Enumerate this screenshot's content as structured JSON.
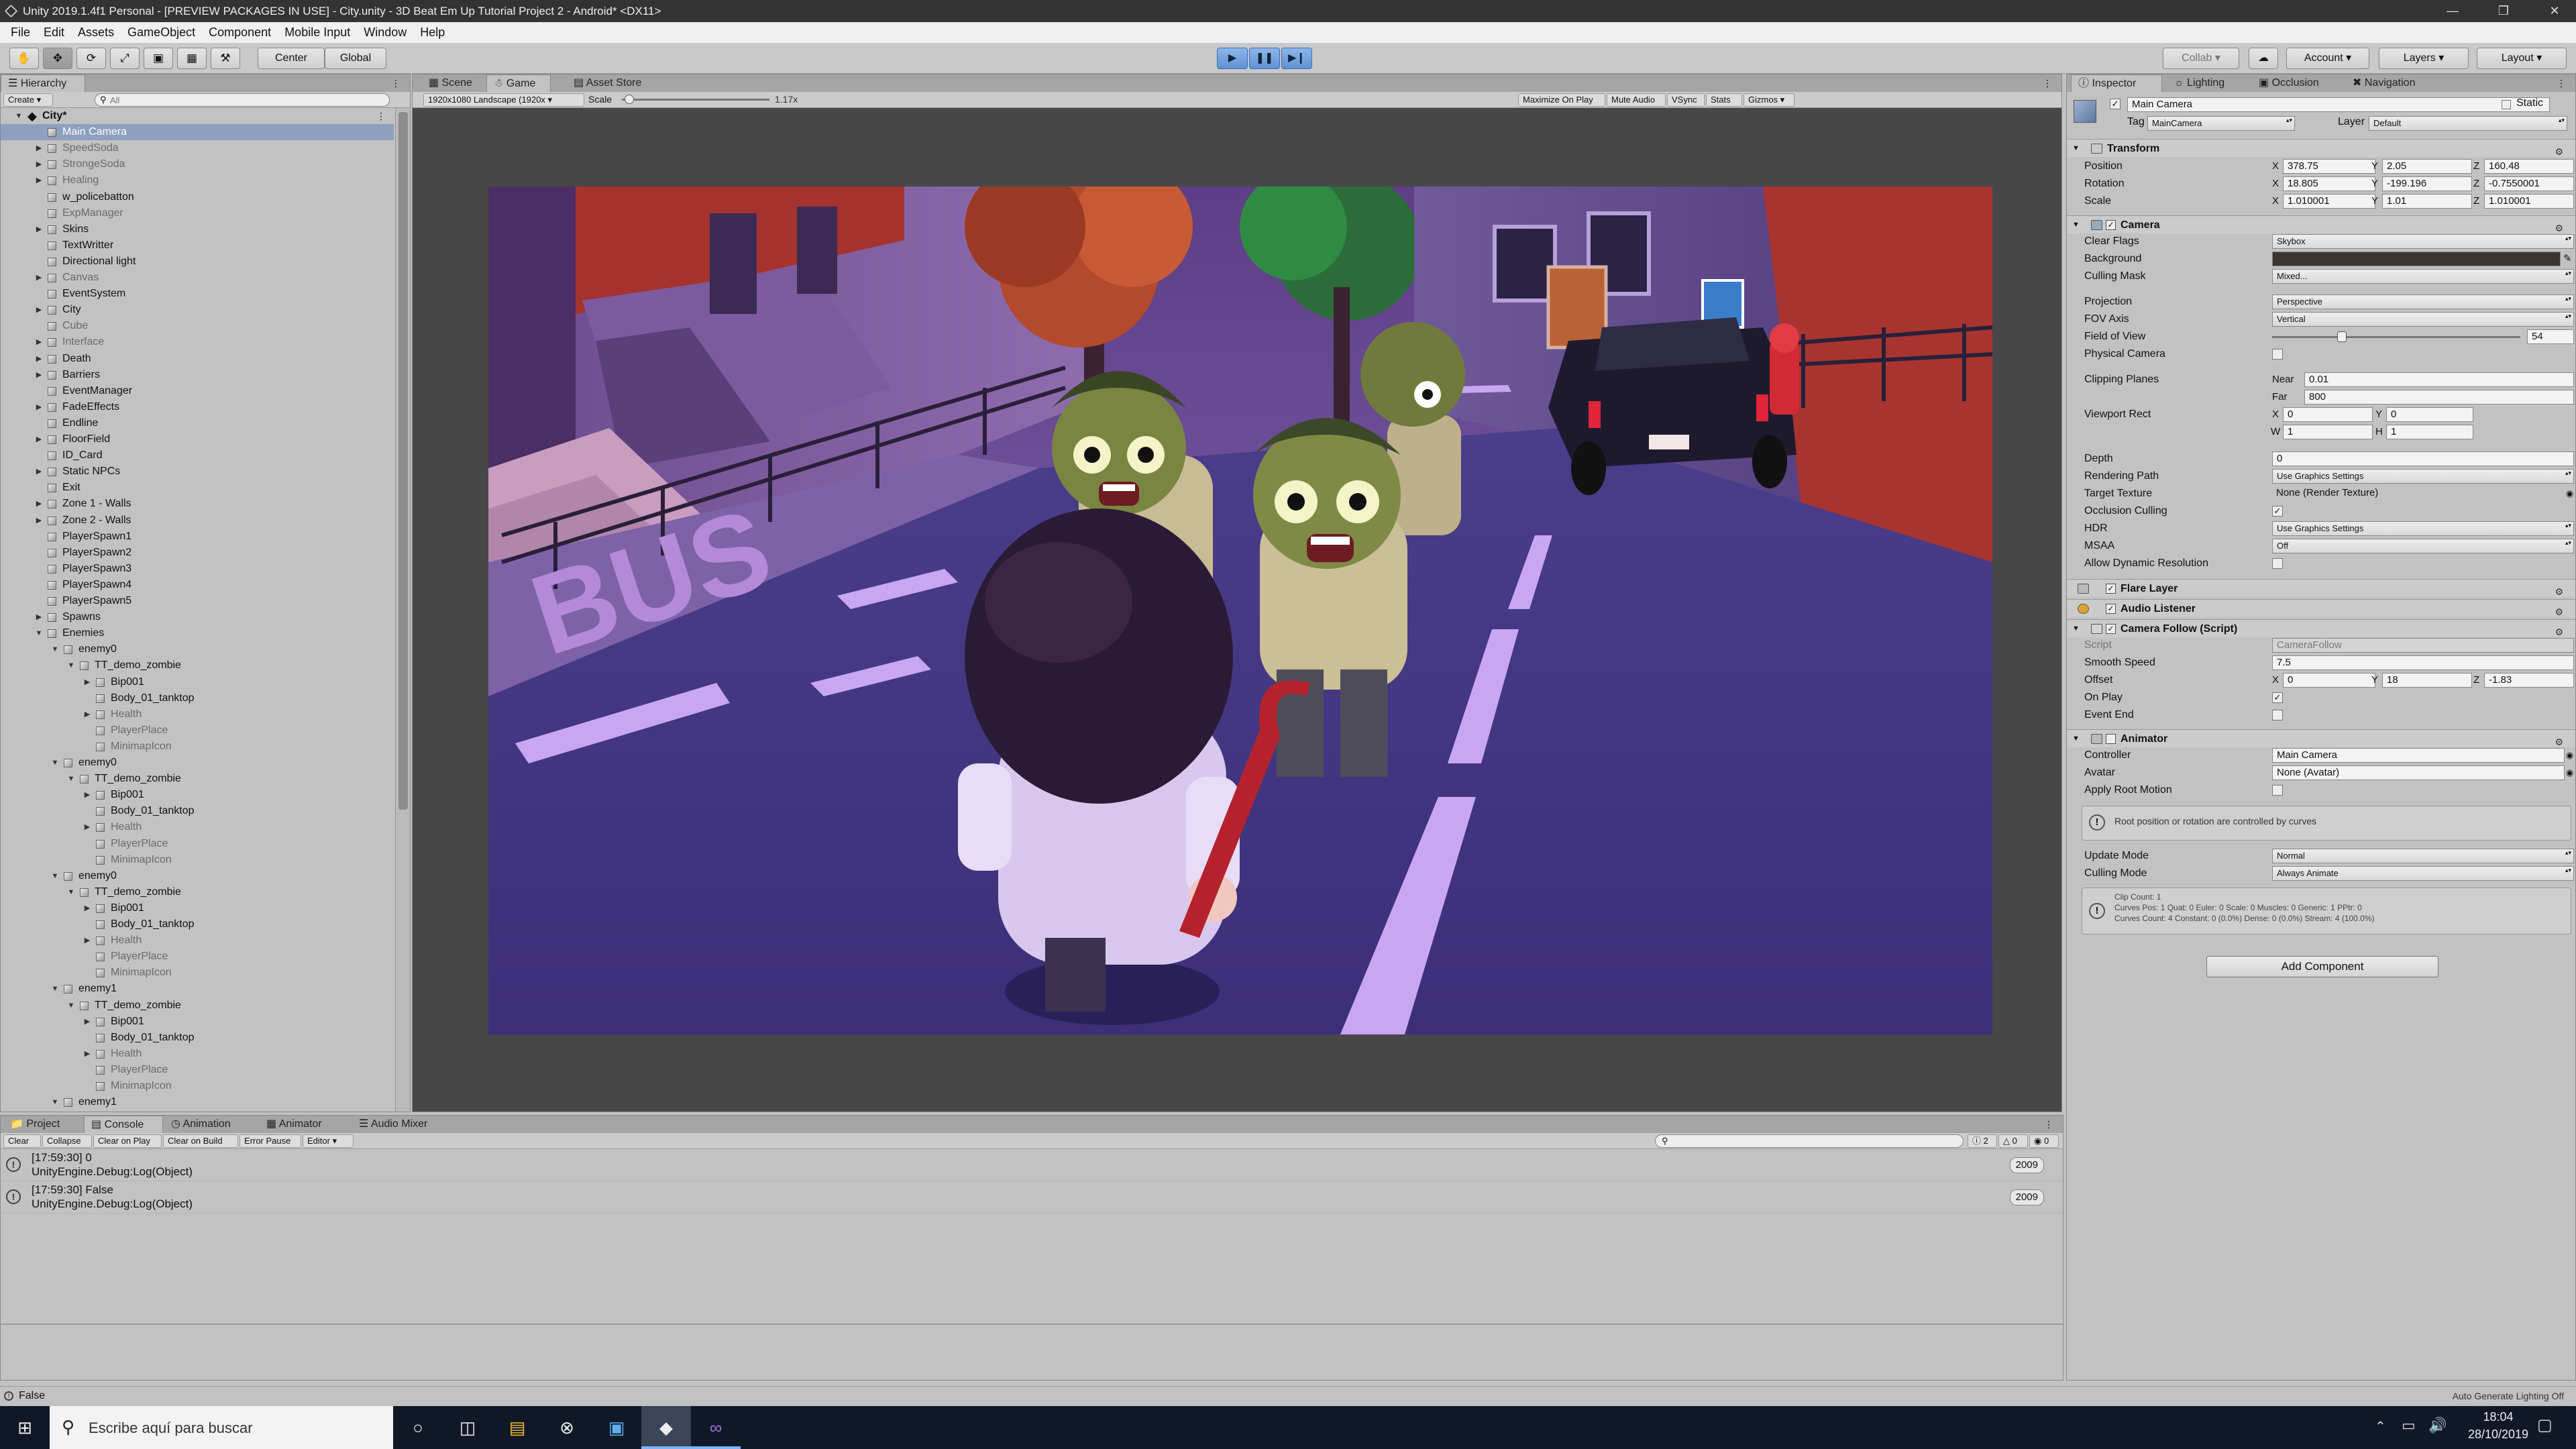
{
  "window": {
    "title": "Unity 2019.1.4f1 Personal - [PREVIEW PACKAGES IN USE] - City.unity - 3D Beat Em Up Tutorial Project 2 - Android* <DX11>"
  },
  "menu": [
    "File",
    "Edit",
    "Assets",
    "GameObject",
    "Component",
    "Mobile Input",
    "Window",
    "Help"
  ],
  "toolbar": {
    "pivot": "Center",
    "space": "Global",
    "collab": "Collab",
    "account": "Account",
    "layers": "Layers",
    "layout": "Layout"
  },
  "hierarchy": {
    "tab": "Hierarchy",
    "create": "Create",
    "search_placeholder": "All",
    "scene": "City*",
    "items": [
      {
        "label": "Main Camera",
        "depth": 1,
        "arrow": "",
        "selected": true,
        "dim": false
      },
      {
        "label": "SpeedSoda",
        "depth": 1,
        "arrow": "right",
        "dim": true
      },
      {
        "label": "StrongeSoda",
        "depth": 1,
        "arrow": "right",
        "dim": true
      },
      {
        "label": "Healing",
        "depth": 1,
        "arrow": "right",
        "dim": true
      },
      {
        "label": "w_policebatton",
        "depth": 1,
        "arrow": "",
        "dim": false
      },
      {
        "label": "ExpManager",
        "depth": 1,
        "arrow": "",
        "dim": true
      },
      {
        "label": "Skins",
        "depth": 1,
        "arrow": "right",
        "dim": false
      },
      {
        "label": "TextWritter",
        "depth": 1,
        "arrow": "",
        "dim": false
      },
      {
        "label": "Directional light",
        "depth": 1,
        "arrow": "",
        "dim": false
      },
      {
        "label": "Canvas",
        "depth": 1,
        "arrow": "right",
        "dim": true
      },
      {
        "label": "EventSystem",
        "depth": 1,
        "arrow": "",
        "dim": false
      },
      {
        "label": "City",
        "depth": 1,
        "arrow": "right",
        "dim": false
      },
      {
        "label": "Cube",
        "depth": 1,
        "arrow": "",
        "dim": true
      },
      {
        "label": "Interface",
        "depth": 1,
        "arrow": "right",
        "dim": true
      },
      {
        "label": "Death",
        "depth": 1,
        "arrow": "right",
        "dim": false
      },
      {
        "label": "Barriers",
        "depth": 1,
        "arrow": "right",
        "dim": false
      },
      {
        "label": "EventManager",
        "depth": 1,
        "arrow": "",
        "dim": false
      },
      {
        "label": "FadeEffects",
        "depth": 1,
        "arrow": "right",
        "dim": false
      },
      {
        "label": "Endline",
        "depth": 1,
        "arrow": "",
        "dim": false
      },
      {
        "label": "FloorField",
        "depth": 1,
        "arrow": "right",
        "dim": false
      },
      {
        "label": "ID_Card",
        "depth": 1,
        "arrow": "",
        "dim": false
      },
      {
        "label": "Static NPCs",
        "depth": 1,
        "arrow": "right",
        "dim": false
      },
      {
        "label": "Exit",
        "depth": 1,
        "arrow": "",
        "dim": false
      },
      {
        "label": "Zone 1 - Walls",
        "depth": 1,
        "arrow": "right",
        "dim": false
      },
      {
        "label": "Zone 2 - Walls",
        "depth": 1,
        "arrow": "right",
        "dim": false
      },
      {
        "label": "PlayerSpawn1",
        "depth": 1,
        "arrow": "",
        "dim": false
      },
      {
        "label": "PlayerSpawn2",
        "depth": 1,
        "arrow": "",
        "dim": false
      },
      {
        "label": "PlayerSpawn3",
        "depth": 1,
        "arrow": "",
        "dim": false
      },
      {
        "label": "PlayerSpawn4",
        "depth": 1,
        "arrow": "",
        "dim": false
      },
      {
        "label": "PlayerSpawn5",
        "depth": 1,
        "arrow": "",
        "dim": false
      },
      {
        "label": "Spawns",
        "depth": 1,
        "arrow": "right",
        "dim": false
      },
      {
        "label": "Enemies",
        "depth": 1,
        "arrow": "down",
        "dim": false
      },
      {
        "label": "enemy0",
        "depth": 2,
        "arrow": "down",
        "dim": false
      },
      {
        "label": "TT_demo_zombie",
        "depth": 3,
        "arrow": "down",
        "dim": false
      },
      {
        "label": "Bip001",
        "depth": 4,
        "arrow": "right",
        "dim": false
      },
      {
        "label": "Body_01_tanktop",
        "depth": 4,
        "arrow": "",
        "dim": false
      },
      {
        "label": "Health",
        "depth": 4,
        "arrow": "right",
        "dim": true
      },
      {
        "label": "PlayerPlace",
        "depth": 4,
        "arrow": "",
        "dim": true
      },
      {
        "label": "MinimapIcon",
        "depth": 4,
        "arrow": "",
        "dim": true
      },
      {
        "label": "enemy0",
        "depth": 2,
        "arrow": "down",
        "dim": false
      },
      {
        "label": "TT_demo_zombie",
        "depth": 3,
        "arrow": "down",
        "dim": false
      },
      {
        "label": "Bip001",
        "depth": 4,
        "arrow": "right",
        "dim": false
      },
      {
        "label": "Body_01_tanktop",
        "depth": 4,
        "arrow": "",
        "dim": false
      },
      {
        "label": "Health",
        "depth": 4,
        "arrow": "right",
        "dim": true
      },
      {
        "label": "PlayerPlace",
        "depth": 4,
        "arrow": "",
        "dim": true
      },
      {
        "label": "MinimapIcon",
        "depth": 4,
        "arrow": "",
        "dim": true
      },
      {
        "label": "enemy0",
        "depth": 2,
        "arrow": "down",
        "dim": false
      },
      {
        "label": "TT_demo_zombie",
        "depth": 3,
        "arrow": "down",
        "dim": false
      },
      {
        "label": "Bip001",
        "depth": 4,
        "arrow": "right",
        "dim": false
      },
      {
        "label": "Body_01_tanktop",
        "depth": 4,
        "arrow": "",
        "dim": false
      },
      {
        "label": "Health",
        "depth": 4,
        "arrow": "right",
        "dim": true
      },
      {
        "label": "PlayerPlace",
        "depth": 4,
        "arrow": "",
        "dim": true
      },
      {
        "label": "MinimapIcon",
        "depth": 4,
        "arrow": "",
        "dim": true
      },
      {
        "label": "enemy1",
        "depth": 2,
        "arrow": "down",
        "dim": false
      },
      {
        "label": "TT_demo_zombie",
        "depth": 3,
        "arrow": "down",
        "dim": false
      },
      {
        "label": "Bip001",
        "depth": 4,
        "arrow": "right",
        "dim": false
      },
      {
        "label": "Body_01_tanktop",
        "depth": 4,
        "arrow": "",
        "dim": false
      },
      {
        "label": "Health",
        "depth": 4,
        "arrow": "right",
        "dim": true
      },
      {
        "label": "PlayerPlace",
        "depth": 4,
        "arrow": "",
        "dim": true
      },
      {
        "label": "MinimapIcon",
        "depth": 4,
        "arrow": "",
        "dim": true
      },
      {
        "label": "enemy1",
        "depth": 2,
        "arrow": "down",
        "dim": false
      }
    ]
  },
  "center": {
    "tabs": [
      "Scene",
      "Game",
      "Asset Store"
    ],
    "active_tab": "Game",
    "resolution": "1920x1080 Landscape (1920x",
    "scale_label": "Scale",
    "scale_value": "1.17x",
    "options": [
      "Maximize On Play",
      "Mute Audio",
      "VSync",
      "Stats",
      "Gizmos"
    ]
  },
  "inspector": {
    "tabs": [
      "Inspector",
      "Lighting",
      "Occlusion",
      "Navigation"
    ],
    "object_name": "Main Camera",
    "static_label": "Static",
    "tag_label": "Tag",
    "tag": "MainCamera",
    "layer_label": "Layer",
    "layer": "Default",
    "transform": {
      "title": "Transform",
      "position_label": "Position",
      "position": [
        "378.75",
        "2.05",
        "160.48"
      ],
      "rotation_label": "Rotation",
      "rotation": [
        "18.805",
        "-199.196",
        "-0.7550001"
      ],
      "scale_label": "Scale",
      "scale": [
        "1.010001",
        "1.01",
        "1.010001"
      ]
    },
    "camera": {
      "title": "Camera",
      "clear_flags_label": "Clear Flags",
      "clear_flags": "Skybox",
      "background_label": "Background",
      "background_color": "#3a3530",
      "culling_mask_label": "Culling Mask",
      "culling_mask": "Mixed...",
      "projection_label": "Projection",
      "projection": "Perspective",
      "fov_axis_label": "FOV Axis",
      "fov_axis": "Vertical",
      "fov_label": "Field of View",
      "fov": "54",
      "fov_fraction": 0.28,
      "physical_label": "Physical Camera",
      "clipping_label": "Clipping Planes",
      "near_label": "Near",
      "near": "0.01",
      "far_label": "Far",
      "far": "800",
      "viewport_label": "Viewport Rect",
      "viewport": {
        "x": "0",
        "y": "0",
        "w": "1",
        "h": "1"
      },
      "depth_label": "Depth",
      "depth": "0",
      "rendering_path_label": "Rendering Path",
      "rendering_path": "Use Graphics Settings",
      "target_texture_label": "Target Texture",
      "target_texture": "None (Render Texture)",
      "occlusion_label": "Occlusion Culling",
      "hdr_label": "HDR",
      "hdr": "Use Graphics Settings",
      "msaa_label": "MSAA",
      "msaa": "Off",
      "dynres_label": "Allow Dynamic Resolution"
    },
    "flare_layer": "Flare Layer",
    "audio_listener": "Audio Listener",
    "camera_follow": {
      "title": "Camera Follow (Script)",
      "script_label": "Script",
      "script": "CameraFollow",
      "smooth_label": "Smooth Speed",
      "smooth": "7.5",
      "offset_label": "Offset",
      "offset": [
        "0",
        "18",
        "-1.83"
      ],
      "onplay_label": "On Play",
      "eventend_label": "Event End"
    },
    "animator": {
      "title": "Animator",
      "controller_label": "Controller",
      "controller": "Main Camera",
      "avatar_label": "Avatar",
      "avatar": "None (Avatar)",
      "rootmotion_label": "Apply Root Motion",
      "info": "Root position or rotation are controlled by curves",
      "update_label": "Update Mode",
      "update": "Normal",
      "culling_label": "Culling Mode",
      "culling": "Always Animate",
      "clip_line1": "Clip Count: 1",
      "clip_line2": "Curves Pos: 1 Quat: 0 Euler: 0 Scale: 0 Muscles: 0 Generic: 1 PPtr: 0",
      "clip_line3": "Curves Count: 4 Constant: 0 (0.0%) Dense: 0 (0.0%) Stream: 4 (100.0%)"
    },
    "add_component": "Add Component"
  },
  "console": {
    "tabs": [
      "Project",
      "Console",
      "Animation",
      "Animator",
      "Audio Mixer"
    ],
    "buttons": [
      "Clear",
      "Collapse",
      "Clear on Play",
      "Clear on Build",
      "Error Pause",
      "Editor"
    ],
    "counts": [
      "2",
      "0",
      "0"
    ],
    "logs": [
      {
        "line1": "[17:59:30] 0",
        "line2": "UnityEngine.Debug:Log(Object)",
        "count": "2009"
      },
      {
        "line1": "[17:59:30] False",
        "line2": "UnityEngine.Debug:Log(Object)",
        "count": "2009"
      }
    ]
  },
  "status": {
    "message": "False",
    "right": "Auto Generate Lighting Off"
  },
  "taskbar": {
    "search_placeholder": "Escribe aquí para buscar",
    "time": "18:04",
    "date": "28/10/2019"
  }
}
